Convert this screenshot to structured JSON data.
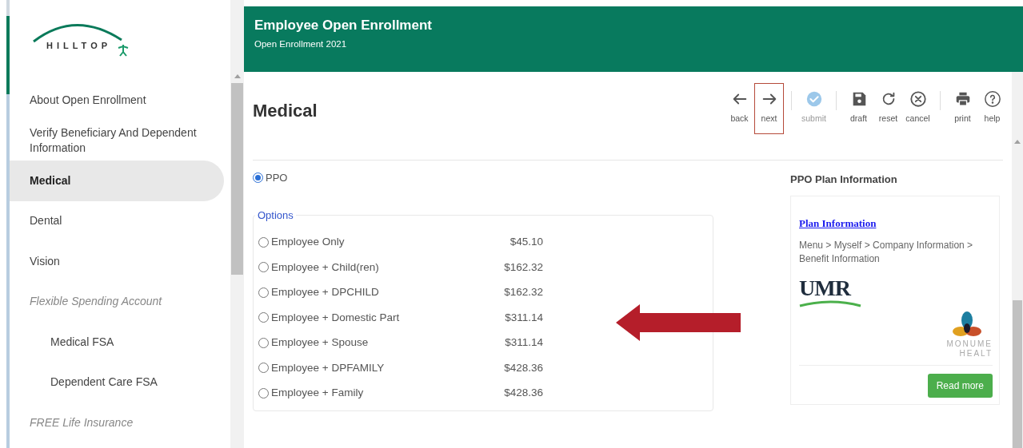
{
  "logo": {
    "text": "HILLTOP"
  },
  "sidebar": {
    "items": [
      {
        "label": "About Open Enrollment",
        "kind": "item",
        "selected": false
      },
      {
        "label": "Verify Beneficiary And Dependent Information",
        "kind": "item",
        "selected": false
      },
      {
        "label": "Medical",
        "kind": "item",
        "selected": true
      },
      {
        "label": "Dental",
        "kind": "item",
        "selected": false
      },
      {
        "label": "Vision",
        "kind": "item",
        "selected": false
      },
      {
        "label": "Flexible Spending Account",
        "kind": "section",
        "selected": false
      },
      {
        "label": "Medical FSA",
        "kind": "subitem",
        "selected": false
      },
      {
        "label": "Dependent Care FSA",
        "kind": "subitem",
        "selected": false
      },
      {
        "label": "FREE Life Insurance",
        "kind": "section",
        "selected": false
      }
    ]
  },
  "header": {
    "title": "Employee Open Enrollment",
    "subtitle": "Open Enrollment 2021"
  },
  "page": {
    "title": "Medical"
  },
  "toolbar_groups": [
    [
      {
        "label": "back",
        "kind": "back",
        "highlighted": false,
        "disabled": false
      },
      {
        "label": "next",
        "kind": "next",
        "highlighted": true,
        "disabled": false
      }
    ],
    [
      {
        "label": "submit",
        "kind": "submit",
        "highlighted": false,
        "disabled": true
      }
    ],
    [
      {
        "label": "draft",
        "kind": "draft",
        "highlighted": false,
        "disabled": false
      },
      {
        "label": "reset",
        "kind": "reset",
        "highlighted": false,
        "disabled": false
      },
      {
        "label": "cancel",
        "kind": "cancel",
        "highlighted": false,
        "disabled": false
      }
    ],
    [
      {
        "label": "print",
        "kind": "print",
        "highlighted": false,
        "disabled": false
      },
      {
        "label": "help",
        "kind": "help",
        "highlighted": false,
        "disabled": false
      }
    ]
  ],
  "plan": {
    "label": "PPO",
    "selected": true
  },
  "options": {
    "legend": "Options",
    "rows": [
      {
        "label": "Employee Only",
        "price": "$45.10",
        "selected": false
      },
      {
        "label": "Employee + Child(ren)",
        "price": "$162.32",
        "selected": false
      },
      {
        "label": "Employee + DPCHILD",
        "price": "$162.32",
        "selected": false
      },
      {
        "label": "Employee + Domestic Part",
        "price": "$311.14",
        "selected": false
      },
      {
        "label": "Employee + Spouse",
        "price": "$311.14",
        "selected": false
      },
      {
        "label": "Employee + DPFAMILY",
        "price": "$428.36",
        "selected": false
      },
      {
        "label": "Employee + Family",
        "price": "$428.36",
        "selected": false
      }
    ]
  },
  "info_panel": {
    "title": "PPO Plan Information",
    "link": "Plan Information",
    "path": "Menu > Myself > Company Information > Benefit Information",
    "logo_1": "UMR",
    "logo_2_line_1": "MONUME",
    "logo_2_line_2": "HEALT",
    "button": "Read more"
  }
}
